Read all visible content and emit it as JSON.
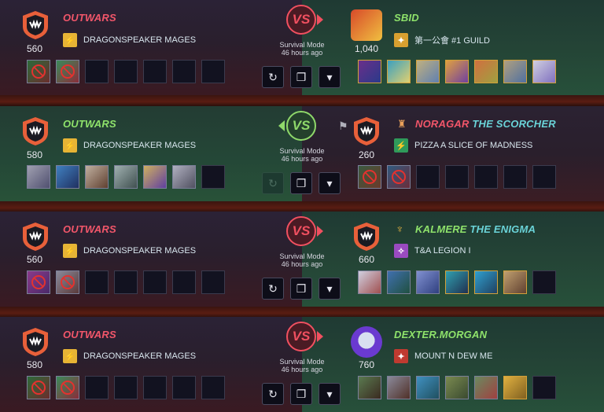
{
  "mode_label": "Survival Mode",
  "time_ago": "46 hours ago",
  "buttons": {
    "replay": "↻",
    "copy": "❐",
    "expand": "▾"
  },
  "battles": [
    {
      "left": {
        "name": "OUTWARS",
        "title": "",
        "rating": "560",
        "guild": "DRAGONSPEAKER MAGES",
        "result": "loss",
        "avatar": "shield-fang-icon"
      },
      "right": {
        "name": "SBID",
        "title": "",
        "rating": "1,040",
        "guild": "第一公會 #1 GUILD",
        "result": "win",
        "avatar": "character-avatar"
      },
      "vs": "VS"
    },
    {
      "left": {
        "name": "OUTWARS",
        "title": "",
        "rating": "580",
        "guild": "DRAGONSPEAKER MAGES",
        "result": "win",
        "avatar": "shield-fang-icon"
      },
      "right": {
        "name": "NORAGAR",
        "title": "THE SCORCHER",
        "rating": "260",
        "guild": "PIZZA A SLICE OF MADNESS",
        "result": "loss",
        "avatar": "shield-fang-icon"
      },
      "vs": "VS"
    },
    {
      "left": {
        "name": "OUTWARS",
        "title": "",
        "rating": "560",
        "guild": "DRAGONSPEAKER MAGES",
        "result": "loss",
        "avatar": "shield-fang-icon"
      },
      "right": {
        "name": "KALMERE",
        "title": "THE ENIGMA",
        "rating": "660",
        "guild": "T&A LEGION I",
        "result": "win",
        "avatar": "shield-fang-icon"
      },
      "vs": "VS"
    },
    {
      "left": {
        "name": "OUTWARS",
        "title": "",
        "rating": "580",
        "guild": "DRAGONSPEAKER MAGES",
        "result": "loss",
        "avatar": "shield-fang-icon"
      },
      "right": {
        "name": "DEXTER.MORGAN",
        "title": "",
        "rating": "760",
        "guild": "MOUNT N DEW ME",
        "result": "win",
        "avatar": "robot-avatar"
      },
      "vs": "VS"
    }
  ],
  "colors": {
    "loss": "#f15060",
    "win": "#8fd86a",
    "title_teal": "#6ad3d8"
  }
}
